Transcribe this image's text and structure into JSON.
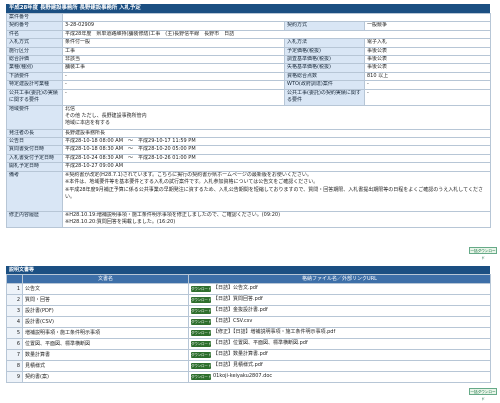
{
  "header": {
    "title": "平成28年度 長野建設事務所 長野建設事務所 入札予定"
  },
  "info_rows": [
    {
      "l1": "案件番号",
      "v1": "",
      "l2": "",
      "v2": ""
    },
    {
      "l1": "契約番号",
      "v1": "3-28-02909",
      "l2": "契約方式",
      "v2": "一般競争"
    },
    {
      "l1": "件名",
      "v1": "平成28年度　県単道路維持(舗装修繕)工事　(主)長野信平線　長野市　日詰",
      "l2": "",
      "v2": ""
    },
    {
      "l1": "入札方式",
      "v1": "条件付一般",
      "l2": "入札方法",
      "v2": "電子入札"
    },
    {
      "l1": "施行区分",
      "v1": "工事",
      "l2": "予定価格(税抜)",
      "v2": "事後公表"
    },
    {
      "l1": "総合評価",
      "v1": "非該当",
      "l2": "調査基準価格(税抜)",
      "v2": "事後公表"
    },
    {
      "l1": "業種(種別)",
      "v1": "舗装工事",
      "l2": "失格基準価格(税抜)",
      "v2": "事後公表"
    },
    {
      "l1": "下請要件",
      "v1": "-",
      "l2": "資格総合点数",
      "v2": "810 以上"
    },
    {
      "l1": "特定建設計可業種",
      "v1": "-",
      "l2": "WTO(政府調達)案件",
      "v2": "-"
    },
    {
      "l1": "公共工事(委託)の実績に関する要件",
      "v1": "-",
      "l2": "公共工事(委託)の契約実績に関する要件",
      "v2": "-"
    },
    {
      "l1": "地域要件",
      "v1": "北信\nその他 ただし、長野建設事務所管内\n地域に本店を有する",
      "l2": "",
      "v2": ""
    },
    {
      "l1": "発注者の長",
      "v1": "長野建設事務所長",
      "l2": "",
      "v2": ""
    },
    {
      "l1": "公告日",
      "v1": "平成28-10-18 08:00 AM　～　平成29-10-17 11:59 PM",
      "l2": "",
      "v2": ""
    },
    {
      "l1": "質問書受付日時",
      "v1": "平成28-10-18 08:30 AM　～　平成28-10-20 05:00 PM",
      "l2": "",
      "v2": ""
    },
    {
      "l1": "入札書受付予定日時",
      "v1": "平成28-10-24 08:30 AM　～　平成28-10-26 01:00 PM",
      "l2": "",
      "v2": ""
    },
    {
      "l1": "開札予定日時",
      "v1": "平成28-10-27 09:00 AM",
      "l2": "",
      "v2": ""
    },
    {
      "l1": "備考",
      "v1": "※契約書が改定(H28.7.1)されています。こちらに掲行の契約書か県ホームページの最新版をお使いください。\n※本件は、地域要件等を基本要件とする入札の試行案件です。入札参加資格については公告文をご確認ください。\n※平成28年度9月補正予算に係る公共事業の早期発注に資するため、入札公告期間を短縮しておりますので、質問・回答期限、入札書提出期限等の日程をよくご確認のうえ入札してください。",
      "l2": "",
      "v2": ""
    },
    {
      "l1": "修正内容履歴",
      "v1": "※H28.10.19:増補説明事項・施工条件明示事項を修正しましたので、ご確認ください。(09:20)\n※H28.10.20:質問回答を掲載しました。(16:20)",
      "l2": "",
      "v2": ""
    }
  ],
  "download_all_label": "一括ダウンロード",
  "docs_section_title": "説明文書等",
  "docs_table": {
    "col_name": "文書名",
    "col_file": "格納ファイル名／外部リンクURL",
    "dl_label": "ダウンロード",
    "rows": [
      {
        "no": "1",
        "name": "公告文",
        "file": "【日詰】公告文.pdf"
      },
      {
        "no": "2",
        "name": "質問・回答",
        "file": "【日詰】質問回答.pdf"
      },
      {
        "no": "3",
        "name": "設計書(PDF)",
        "file": "【日詰】金抜設計書.pdf"
      },
      {
        "no": "4",
        "name": "設計書(CSV)",
        "file": "【日詰】CSV.csv"
      },
      {
        "no": "5",
        "name": "増補説明事項・施工条件明示事項",
        "file": "【修正】【日詰】増補説明事項・施工条件明示事項.pdf"
      },
      {
        "no": "6",
        "name": "位置図、平面図、標準横断図",
        "file": "【日詰】位置図、平面図、標準横断図.pdf"
      },
      {
        "no": "7",
        "name": "数量計算書",
        "file": "【日詰】数量計算書.pdf"
      },
      {
        "no": "8",
        "name": "見積様式",
        "file": "【日詰】見積様式.pdf"
      },
      {
        "no": "9",
        "name": "契約書(案)",
        "file": "01koji-keiyaku2807.doc"
      }
    ]
  }
}
